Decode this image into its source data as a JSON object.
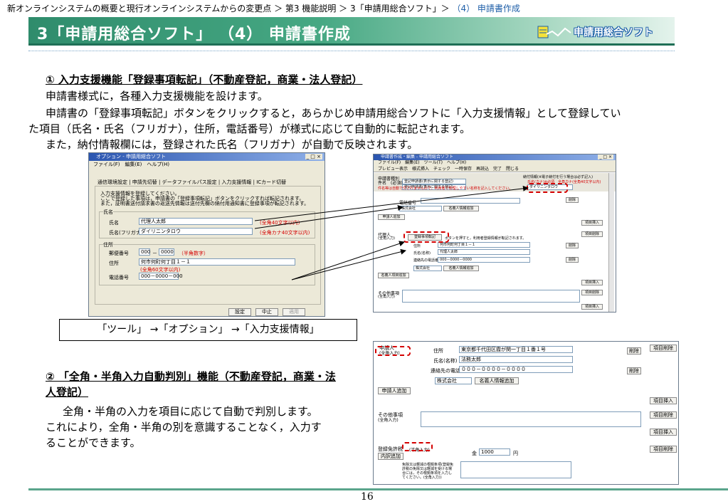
{
  "breadcrumb": {
    "path": "新オンラインシステムの概要と現行オンラインシステムからの変更点 ＞ 第3 機能説明 ＞ 3「申請用総合ソフト」＞",
    "current": "（4） 申請書作成"
  },
  "banner": {
    "title": "3「申請用総合ソフト」 （4） 申請書作成",
    "logo": "申請用総合ソフト"
  },
  "section1": {
    "heading": "① 入力支援機能「登録事項転記」（不動産登記，商業・法人登記）",
    "lines": [
      "申請書様式に，各種入力支援機能を設けます。",
      "申請書の「登録事項転記」ボタンをクリックすると，あらかじめ申請用総合ソフトに「入力支援情報」として登録してい",
      "た項目（氏名・氏名（フリガナ），住所，電話番号）が様式に応じて自動的に転記されます。",
      "また，納付情報欄には，登録された氏名（フリガナ）が自動で反映されます。"
    ]
  },
  "options_window": {
    "title": "オプション - 申請用総合ソフト",
    "menu": "ファイル(F)　編集(E)　ヘルプ(H)",
    "tabs": "通信環境設定 | 申請先切替 | データファイルパス設定 | 入力支援情報 | ICカード切替",
    "note1": "入力支援情報を登録してください。",
    "note2": "ここで登録した事項は，申請書の「登録事項転記」ボタンをクリックすれば転記されます。",
    "note3": "また，証明書送付請求書の返送先情報は送付先欄の納付用通知書に登録事項が転記されます。",
    "group_name": "氏名",
    "name_label": "氏名",
    "name_value": "代理人太郎",
    "name_hint": "(全角40文字以内)",
    "kana_label": "氏名(フリガナ)",
    "kana_value": "ダイリニンタロウ",
    "kana_hint": "(全角カナ40文字以内)",
    "group_address": "住所",
    "zip_label": "郵便番号",
    "zip1": "000",
    "zip_dash": "－",
    "zip2": "0000",
    "zip_hint": "（半角数字）",
    "addr_label": "住所",
    "addr_value": "何市何町何丁目１－１",
    "addr_hint": "(全角60文字以内)",
    "tel_label": "電話番号",
    "tel_value": "000－0000－000",
    "btn_ok": "設定",
    "btn_cancel": "中止",
    "btn_apply": "適用"
  },
  "caption": "「ツール」 →「オプション」 →「入力支援情報」",
  "form_window": {
    "title": "申請書作成・編集 - 申請用総合ソフト",
    "menu": "ファイル(F)　編集(E)　ツール(T)　ヘルプ(H)",
    "toolbar": "プレビュー表示　様式挿入　チェック　一時保存　再読込　完了　閉じる",
    "pay_label": "納付情報(※電子納付を行う場合は必ず記入)",
    "pay_name_label": "氏名(カナ)※必須　全角カナ(全角40文字以内)",
    "pay_name_value": "ダイリニンタロウ",
    "app_type_label": "申請書種別",
    "app_type_value": "登記申請書(表示に関する登記)",
    "app_name_label": "件名　(必須)",
    "app_name_value": "登記申請書(表示に関する登記)",
    "warn": "件名等は自動で付されませんので，利用者で管理しやすい名称を記入してください。",
    "tel_label": "電話番号",
    "delete": "削除",
    "corp": "株式会社",
    "kubun_add": "名義人情報追加",
    "applicant_add": "申請人追加",
    "insert": "項目挿入",
    "item_delete": "項目削除",
    "agent_label": "代理人",
    "agent_sub": "(全角入力)",
    "transfer_btn": "登録事項転記",
    "transfer_note": "ボタンを押すと，利用者登録情報が転記されます。",
    "addr_label": "住所",
    "addr_value": "何市何町何丁目１－１",
    "name_label": "氏名(名称)",
    "name_value": "代理人太郎",
    "contact_label": "連絡先の電話番号",
    "contact_value": "000－0000－0000",
    "corp2": "株式会社",
    "kubun_add2": "名義人情報追加",
    "sub_add": "名義人項目追加",
    "other_label": "その他事項",
    "other_sub": "(全角入力)"
  },
  "section2": {
    "heading": "② 「全角・半角入力自動判別」機能（不動産登記，商業・法人登記）",
    "lines": [
      "全角・半角の入力を項目に応じて自動で判別します。",
      "これにより，全角・半角の別を意識することなく，入力す",
      "ることができます。"
    ]
  },
  "form2": {
    "applicant_label": "申請人",
    "applicant_sub": "(全角入力)",
    "addr_label": "住所",
    "addr_value": "東京都千代田区霞が関一丁目１番１号",
    "name_label": "氏名(名称)",
    "name_value": "法務太郎",
    "contact_label": "連絡先の電話番号",
    "contact_value": "０００－００００－００００",
    "delete": "削除",
    "item_delete": "項目削除",
    "corp": "株式会社",
    "kubun_add": "名義人情報追加",
    "applicant_add": "申請人追加",
    "insert": "項目挿入",
    "other_label": "その他事項",
    "other_sub": "(全角入力)",
    "tax_label": "登録免許税",
    "tax_sub": "(半角入力)",
    "breakdown_btn": "内訳追加",
    "yen_prefix": "金",
    "tax_value": "1000",
    "yen": "円",
    "exempt_label": "免除又は軽減の根拠条項(登録免許税の免除又は軽減を受ける場合には，その根拠条項を入力してください。(全角入力))"
  },
  "page_number": "16"
}
